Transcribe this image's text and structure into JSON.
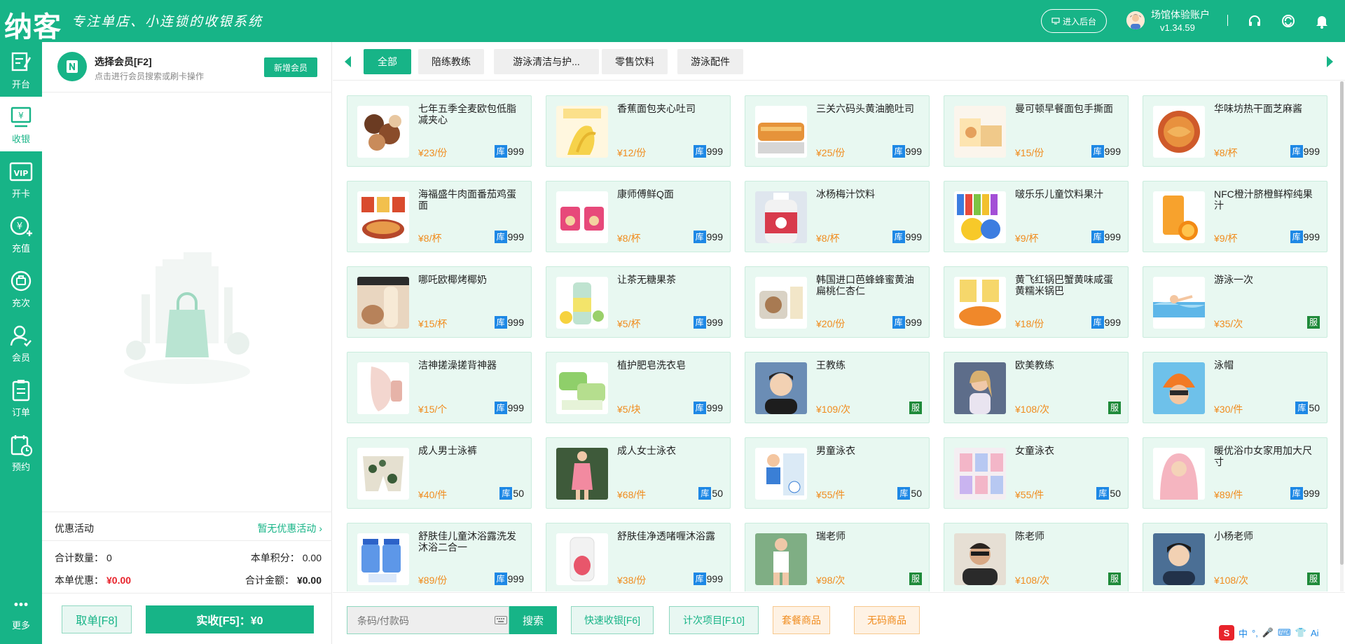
{
  "header": {
    "logo": "纳客",
    "slogan": "专注单店、小连锁的收银系统",
    "admin_btn": "进入后台",
    "account_name": "场馆体验账户",
    "version": "v1.34.59"
  },
  "nav": [
    {
      "label": "开台",
      "icon": "table-icon"
    },
    {
      "label": "收银",
      "icon": "cashier-icon"
    },
    {
      "label": "开卡",
      "icon": "vip-card-icon"
    },
    {
      "label": "充值",
      "icon": "recharge-icon"
    },
    {
      "label": "充次",
      "icon": "times-icon"
    },
    {
      "label": "会员",
      "icon": "member-icon"
    },
    {
      "label": "订单",
      "icon": "order-icon"
    },
    {
      "label": "预约",
      "icon": "booking-icon"
    }
  ],
  "nav_more": "更多",
  "member": {
    "title": "选择会员[F2]",
    "subtitle": "点击进行会员搜索或刷卡操作",
    "new_btn": "新增会员"
  },
  "summary": {
    "promo_label": "优惠活动",
    "promo_value": "暂无优惠活动",
    "qty_label": "合计数量：",
    "qty_value": "0",
    "points_label": "本单积分：",
    "points_value": "0.00",
    "discount_label": "本单优惠：",
    "discount_value": "¥0.00",
    "total_label": "合计金额：",
    "total_value": "¥0.00"
  },
  "actions": {
    "cancel": "取单[F8]",
    "pay": "实收[F5]：¥0"
  },
  "tabs": [
    {
      "label": "全部",
      "active": true
    },
    {
      "label": "陪练教练",
      "active": false
    },
    {
      "label": "游泳清洁与护...",
      "active": false
    },
    {
      "label": "零售饮料",
      "active": false
    },
    {
      "label": "游泳配件",
      "active": false
    }
  ],
  "products": [
    {
      "name": "七年五季全麦欧包低脂减夹心",
      "price": "¥23/份",
      "badge": "库",
      "stock": "999",
      "img": "bread"
    },
    {
      "name": "香蕉面包夹心吐司",
      "price": "¥12/份",
      "badge": "库",
      "stock": "999",
      "img": "banana"
    },
    {
      "name": "三关六码头黄油脆吐司",
      "price": "¥25/份",
      "badge": "库",
      "stock": "999",
      "img": "toast"
    },
    {
      "name": "曼可顿早餐面包手撕面",
      "price": "¥15/份",
      "badge": "库",
      "stock": "999",
      "img": "breakfast"
    },
    {
      "name": "华味坊热干面芝麻酱",
      "price": "¥8/杯",
      "badge": "库",
      "stock": "999",
      "img": "noodle"
    },
    {
      "name": "海福盛牛肉面番茄鸡蛋面",
      "price": "¥8/杯",
      "badge": "库",
      "stock": "999",
      "img": "cupnoodle"
    },
    {
      "name": "康师傅鲜Q面",
      "price": "¥8/杯",
      "badge": "库",
      "stock": "999",
      "img": "qnoodle"
    },
    {
      "name": "冰杨梅汁饮料",
      "price": "¥8/杯",
      "badge": "库",
      "stock": "999",
      "img": "bottle"
    },
    {
      "name": "啵乐乐儿童饮料果汁",
      "price": "¥9/杯",
      "badge": "库",
      "stock": "999",
      "img": "kidsdrink"
    },
    {
      "name": "NFC橙汁脐橙鲜榨纯果汁",
      "price": "¥9/杯",
      "badge": "库",
      "stock": "999",
      "img": "orange"
    },
    {
      "name": "哪吒欧椰烤椰奶",
      "price": "¥15/杯",
      "badge": "库",
      "stock": "999",
      "img": "coconut"
    },
    {
      "name": "让茶无糖果茶",
      "price": "¥5/杯",
      "badge": "库",
      "stock": "999",
      "img": "tea"
    },
    {
      "name": "韩国进口芭蜂蜂蜜黄油扁桃仁杏仁",
      "price": "¥20/份",
      "badge": "库",
      "stock": "999",
      "img": "almond"
    },
    {
      "name": "黄飞红锅巴蟹黄味咸蛋黄糯米锅巴",
      "price": "¥18/份",
      "badge": "库",
      "stock": "999",
      "img": "snack"
    },
    {
      "name": "游泳一次",
      "price": "¥35/次",
      "badge": "服",
      "stock": "",
      "img": "swim"
    },
    {
      "name": "洁神搓澡搓背神器",
      "price": "¥15/个",
      "badge": "库",
      "stock": "999",
      "img": "scrub"
    },
    {
      "name": "植护肥皂洗衣皂",
      "price": "¥5/块",
      "badge": "库",
      "stock": "999",
      "img": "soap"
    },
    {
      "name": "王教练",
      "price": "¥109/次",
      "badge": "服",
      "stock": "",
      "img": "coach1"
    },
    {
      "name": "欧美教练",
      "price": "¥108/次",
      "badge": "服",
      "stock": "",
      "img": "coach2"
    },
    {
      "name": "泳帽",
      "price": "¥30/件",
      "badge": "库",
      "stock": "50",
      "img": "cap"
    },
    {
      "name": "成人男士泳裤",
      "price": "¥40/件",
      "badge": "库",
      "stock": "50",
      "img": "trunks"
    },
    {
      "name": "成人女士泳衣",
      "price": "¥68/件",
      "badge": "库",
      "stock": "50",
      "img": "swimsuit"
    },
    {
      "name": "男童泳衣",
      "price": "¥55/件",
      "badge": "库",
      "stock": "50",
      "img": "boysuit"
    },
    {
      "name": "女童泳衣",
      "price": "¥55/件",
      "badge": "库",
      "stock": "50",
      "img": "girlsuit"
    },
    {
      "name": "暖优浴巾女家用加大尺寸",
      "price": "¥89/件",
      "badge": "库",
      "stock": "999",
      "img": "towel"
    },
    {
      "name": "舒肤佳儿童沐浴露洗发沐浴二合一",
      "price": "¥89/份",
      "badge": "库",
      "stock": "999",
      "img": "bodywash"
    },
    {
      "name": "舒肤佳净透啫喱沐浴露",
      "price": "¥38/份",
      "badge": "库",
      "stock": "999",
      "img": "gel"
    },
    {
      "name": "瑞老师",
      "price": "¥98/次",
      "badge": "服",
      "stock": "",
      "img": "coach3"
    },
    {
      "name": "陈老师",
      "price": "¥108/次",
      "badge": "服",
      "stock": "",
      "img": "coach4"
    },
    {
      "name": "小杨老师",
      "price": "¥108/次",
      "badge": "服",
      "stock": "",
      "img": "coach5"
    }
  ],
  "bottom": {
    "search_placeholder": "条码/付款码",
    "search_btn": "搜索",
    "quick_cash": "快速收银[F6]",
    "count_item": "计次项目[F10]",
    "package": "套餐商品",
    "no_code": "无码商品"
  },
  "ime": {
    "label": "中",
    "ai": "Ai"
  },
  "colors": {
    "brand": "#17b487",
    "price": "#f08c1e",
    "stock_badge": "#1e88e5",
    "service_badge": "#1f8a3a",
    "danger": "#e8242c"
  }
}
